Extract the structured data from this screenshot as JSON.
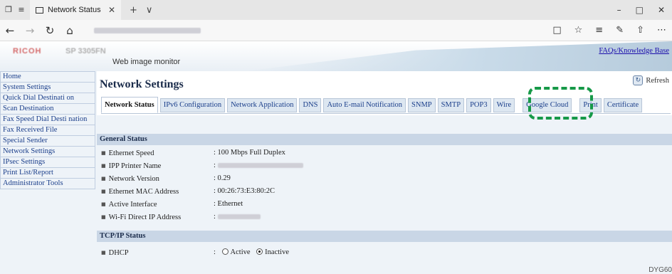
{
  "browser": {
    "tab_title": "Network Status",
    "new_tab": "+",
    "tab_menu": "∨",
    "win_min": "–",
    "win_max": "□",
    "win_close": "✕",
    "back": "←",
    "forward": "→",
    "reload": "↻",
    "home": "⌂",
    "reading": "□",
    "favorite": "☆",
    "hub": "≡",
    "notes": "✎",
    "share": "⇧",
    "more": "⋯"
  },
  "banner": {
    "web_image_monitor": "Web image monitor",
    "faq_link": "FAQs/Knowledge Base"
  },
  "menu": {
    "items": [
      "Home",
      "System Settings",
      "Quick Dial Destinati on",
      "Scan Destination",
      "Fax Speed Dial Desti nation",
      "Fax Received File",
      "Special Sender",
      "Network Settings",
      "IPsec Settings",
      "Print List/Report",
      "Administrator Tools"
    ]
  },
  "main": {
    "title": "Network Settings",
    "refresh": "Refresh",
    "tabs": [
      "Network Status",
      "IPv6 Configuration",
      "Network Application",
      "DNS",
      "Auto E-mail Notification",
      "SNMP",
      "SMTP",
      "POP3",
      "Wire",
      "Google Cloud",
      "Print",
      "Certificate"
    ],
    "general_status": {
      "heading": "General Status",
      "rows": [
        {
          "label": "Ethernet Speed",
          "value": ": 100 Mbps Full Duplex"
        },
        {
          "label": "IPP Printer Name",
          "value": ":"
        },
        {
          "label": "Network Version",
          "value": ": 0.29"
        },
        {
          "label": "Ethernet MAC Address",
          "value": ": 00:26:73:E3:80:2C"
        },
        {
          "label": "Active Interface",
          "value": ": Ethernet"
        },
        {
          "label": "Wi-Fi Direct IP Address",
          "value": ":"
        }
      ]
    },
    "tcpip_status": {
      "heading": "TCP/IP Status",
      "dhcp_label": "DHCP",
      "colon": ":",
      "active": "Active",
      "inactive": "Inactive",
      "selected": "Inactive"
    }
  },
  "footer_code": "DYG60",
  "colors": {
    "highlight": "#169948",
    "menu_link": "#1b3f8b",
    "section_bg": "#c9d6e6"
  }
}
